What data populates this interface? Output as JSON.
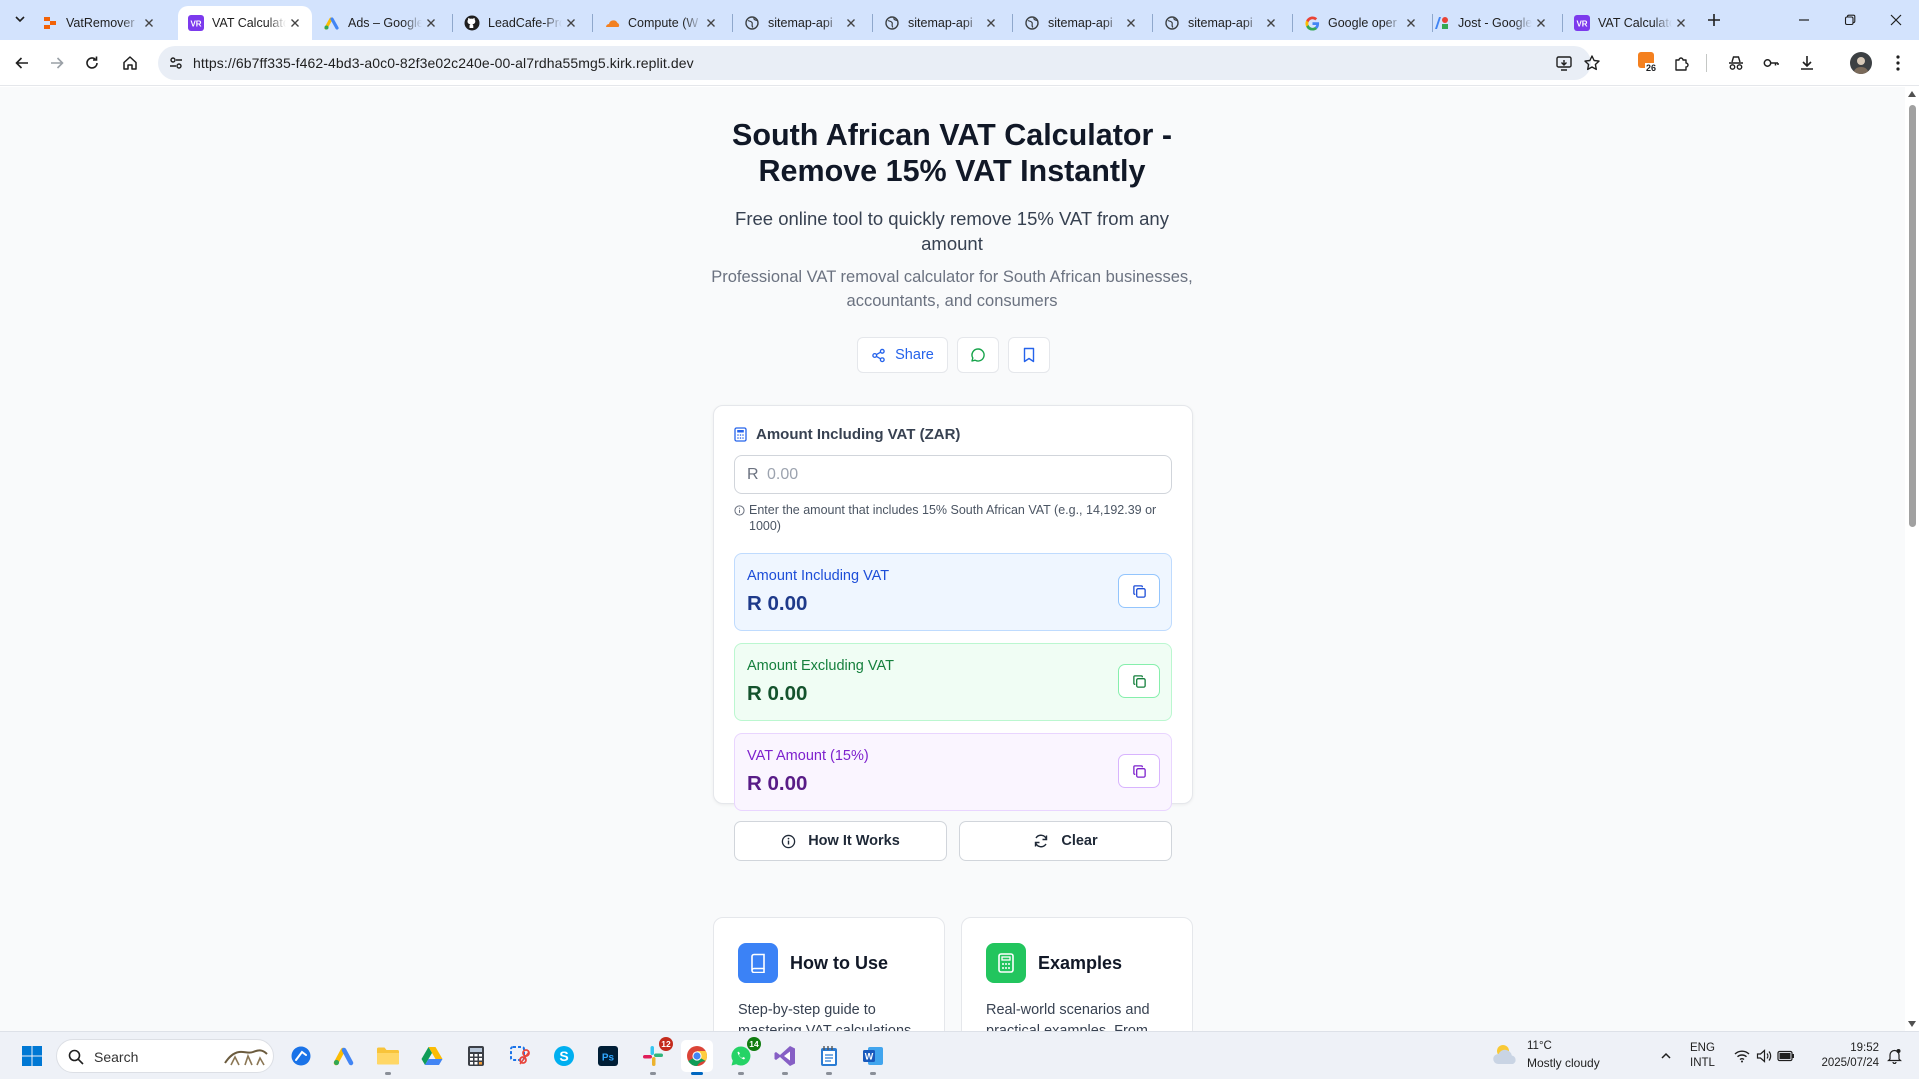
{
  "browser": {
    "tabs": [
      {
        "title": "VatRemover",
        "icon": "replit-icon",
        "active": false
      },
      {
        "title": "VAT Calculator",
        "icon": "vr-app-icon",
        "active": true
      },
      {
        "title": "Ads – Google",
        "icon": "google-ads-icon",
        "active": false
      },
      {
        "title": "LeadCafe-Pro",
        "icon": "github-icon",
        "active": false
      },
      {
        "title": "Compute (W",
        "icon": "cloudflare-icon",
        "active": false
      },
      {
        "title": "sitemap-api",
        "icon": "globe-icon",
        "active": false
      },
      {
        "title": "sitemap-api",
        "icon": "globe-icon",
        "active": false
      },
      {
        "title": "sitemap-api",
        "icon": "globe-icon",
        "active": false
      },
      {
        "title": "sitemap-api",
        "icon": "globe-icon",
        "active": false
      },
      {
        "title": "Google oper",
        "icon": "google-icon",
        "active": false
      },
      {
        "title": "Jost - Google",
        "icon": "google-fonts-icon",
        "active": false
      },
      {
        "title": "VAT Calculator",
        "icon": "vr-app-icon",
        "active": false
      }
    ],
    "url": "https://6b7ff335-f462-4bd3-a0c0-82f3e02c240e-00-al7rdha55mg5.kirk.replit.dev",
    "extension_badge": "26"
  },
  "page": {
    "title": "South African VAT Calculator - Remove 15% VAT Instantly",
    "subtitle": "Free online tool to quickly remove 15% VAT from any amount",
    "description": "Professional VAT removal calculator for South African businesses, accountants, and consumers",
    "share_label": "Share",
    "calculator": {
      "input_label": "Amount Including VAT (ZAR)",
      "currency_prefix": "R",
      "input_placeholder": "0.00",
      "input_value": "",
      "hint": "Enter the amount that includes 15% South African VAT (e.g., 14,192.39 or 1000)",
      "results": [
        {
          "label": "Amount Including VAT",
          "value": "R 0.00"
        },
        {
          "label": "Amount Excluding VAT",
          "value": "R 0.00"
        },
        {
          "label": "VAT Amount (15%)",
          "value": "R 0.00"
        }
      ],
      "how_it_works_label": "How It Works",
      "clear_label": "Clear"
    },
    "info_cards": [
      {
        "title": "How to Use",
        "description": "Step-by-step guide to mastering VAT calculations.",
        "icon": "book-icon",
        "color": "#3b82f6"
      },
      {
        "title": "Examples",
        "description": "Real-world scenarios and practical examples. From",
        "icon": "calculator-icon",
        "color": "#22c55e"
      }
    ]
  },
  "taskbar": {
    "search_placeholder": "Search",
    "badges": {
      "slack": "12",
      "whatsapp": "14"
    },
    "weather": {
      "temp": "11°C",
      "desc": "Mostly cloudy"
    },
    "language": {
      "line1": "ENG",
      "line2": "INTL"
    },
    "time": "19:52",
    "date": "2025/07/24"
  }
}
